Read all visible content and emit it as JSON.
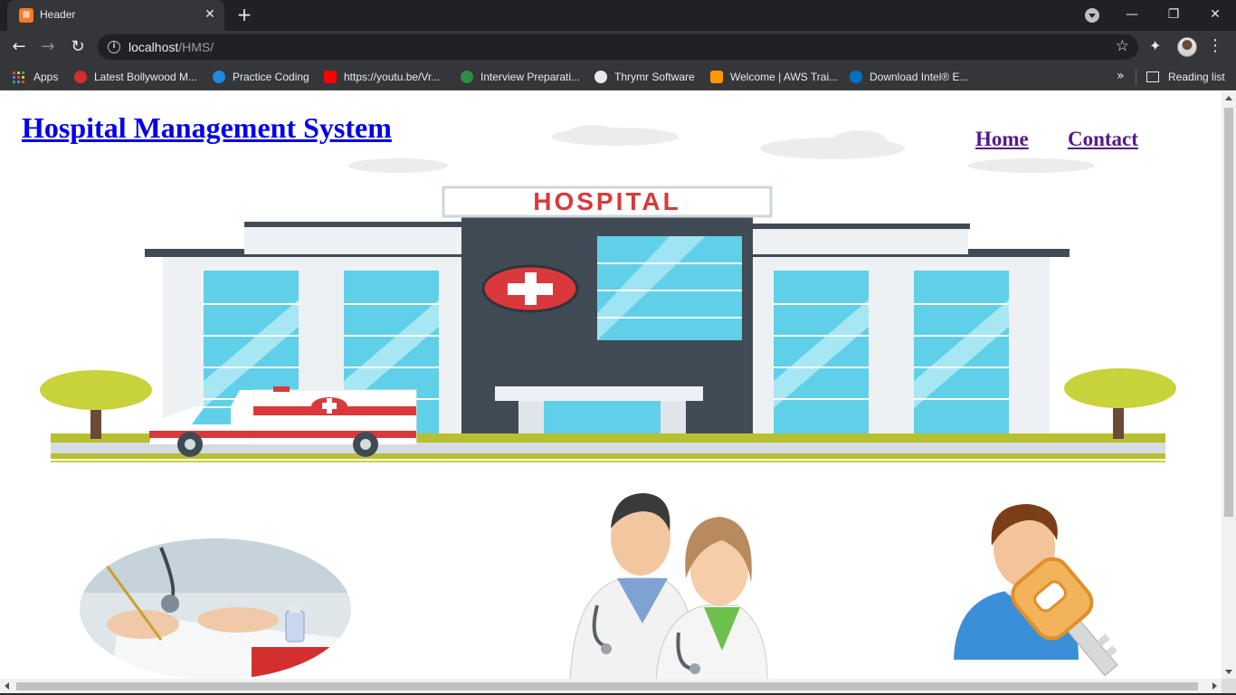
{
  "browser": {
    "tab": {
      "title": "Header",
      "favicon": "xampp-icon"
    },
    "url": {
      "host": "localhost",
      "path": "/HMS/"
    },
    "bookmarks": [
      {
        "label": "Apps",
        "icon": "apps-grid-icon"
      },
      {
        "label": "Latest Bollywood M...",
        "icon": "bollywood-icon",
        "color": "#d32f2f"
      },
      {
        "label": "Practice Coding",
        "icon": "practice-icon",
        "color": "#1e88e5"
      },
      {
        "label": "https://youtu.be/Vr...",
        "icon": "youtube-icon",
        "color": "#ff0000"
      },
      {
        "label": "Interview Preparati...",
        "icon": "gfg-icon",
        "color": "#2f8d46"
      },
      {
        "label": "Thrymr Software",
        "icon": "globe-icon",
        "color": "#e8eaed"
      },
      {
        "label": "Welcome | AWS Trai...",
        "icon": "aws-icon",
        "color": "#ff9900"
      },
      {
        "label": "Download Intel® E...",
        "icon": "intel-icon",
        "color": "#0071c5"
      }
    ],
    "reading_list": "Reading list",
    "overflow": "»"
  },
  "page": {
    "title": "Hospital Management System",
    "nav": [
      "Home",
      "Contact"
    ],
    "hero_sign": "HOSPITAL",
    "colors": {
      "title_link": "#0000ee",
      "visited_link": "#551a8b",
      "sign_red": "#d9393b",
      "building_dark": "#414b55",
      "glass": "#5fd0e8"
    }
  }
}
